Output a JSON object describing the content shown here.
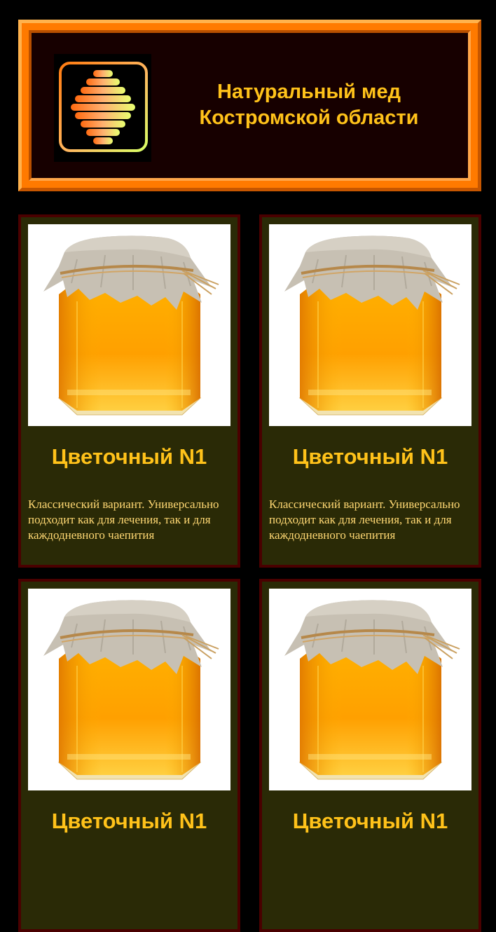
{
  "header": {
    "logo_icon": "honeycomb-logo-icon",
    "title_line1": "Натуральный мед",
    "title_line2": "Костромской области"
  },
  "colors": {
    "page_background": "#000000",
    "header_frame": "#ff7a00",
    "header_background": "#170000",
    "card_background": "#2a2a06",
    "card_border": "#4a0000",
    "title_text": "#ffc21a",
    "description_text": "#ffd873"
  },
  "products": [
    {
      "image": "honey-jar-image",
      "name": "Цветочный N1",
      "description": "Классический вариант. Универсально подходит как для лечения, так и для каждодневного чаепития"
    },
    {
      "image": "honey-jar-image",
      "name": "Цветочный N1",
      "description": "Классический вариант. Универсально подходит как для лечения, так и для каждодневного чаепития"
    },
    {
      "image": "honey-jar-image",
      "name": "Цветочный N1",
      "description": ""
    },
    {
      "image": "honey-jar-image",
      "name": "Цветочный N1",
      "description": ""
    }
  ]
}
